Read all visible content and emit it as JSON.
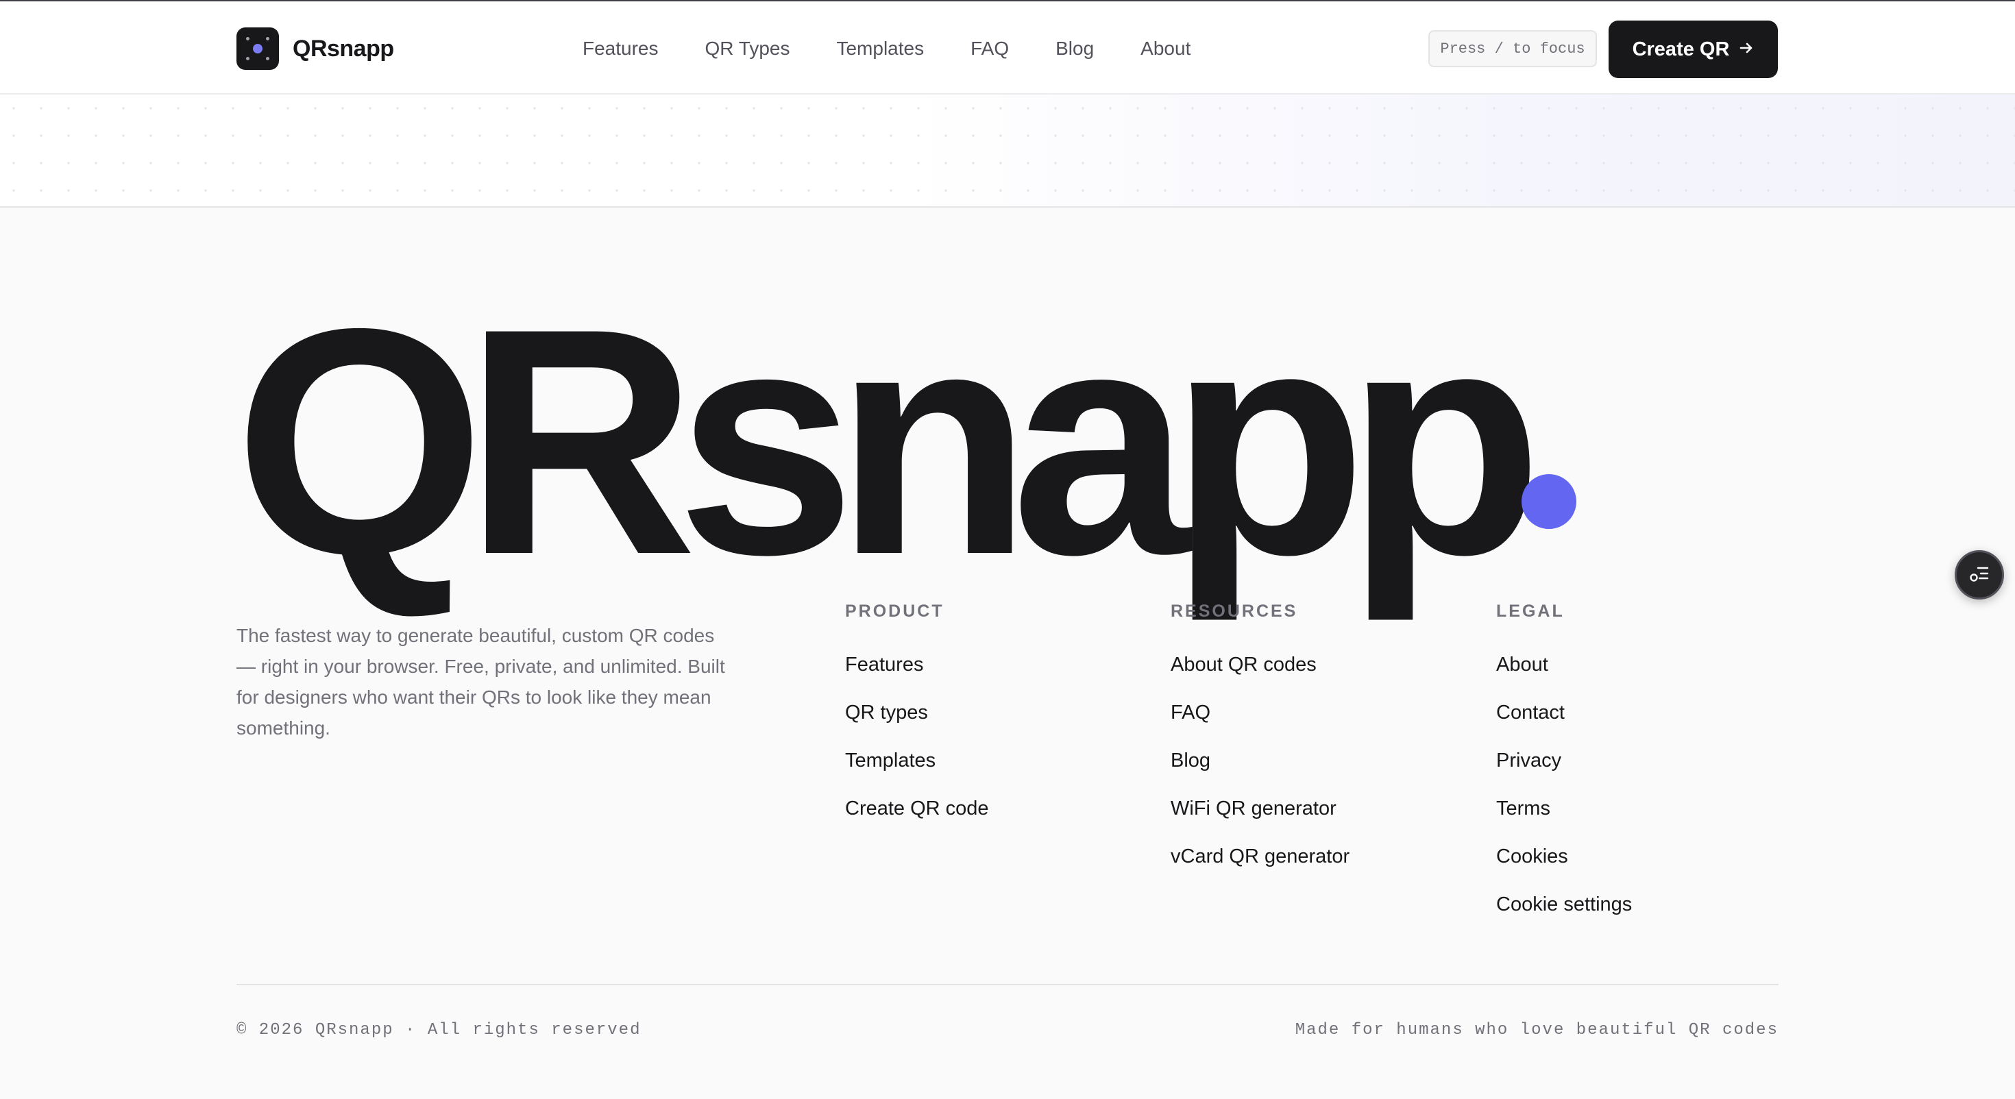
{
  "header": {
    "brand_name": "QRsnapp",
    "brand_icon": "qr-dot-logo-icon",
    "nav": [
      {
        "label": "Features"
      },
      {
        "label": "QR Types"
      },
      {
        "label": "Templates"
      },
      {
        "label": "FAQ"
      },
      {
        "label": "Blog"
      },
      {
        "label": "About"
      }
    ],
    "search_hint": "Press / to focus",
    "cta_label": "Create QR",
    "cta_icon": "arrow-right-icon"
  },
  "footer": {
    "wordmark": "QRsnapp",
    "accent_color": "#6366f1",
    "tagline": "The fastest way to generate beautiful, custom QR codes — right in your browser. Free, private, and unlimited. Built for designers who want their QRs to look like they mean something.",
    "columns": [
      {
        "title": "PRODUCT",
        "links": [
          "Features",
          "QR types",
          "Templates",
          "Create QR code"
        ]
      },
      {
        "title": "RESOURCES",
        "links": [
          "About QR codes",
          "FAQ",
          "Blog",
          "WiFi QR generator",
          "vCard QR generator"
        ]
      },
      {
        "title": "LEGAL",
        "links": [
          "About",
          "Contact",
          "Privacy",
          "Terms",
          "Cookies",
          "Cookie settings"
        ]
      }
    ],
    "copyright": "© 2026 QRsnapp · All rights reserved",
    "made_for": "Made for humans who love beautiful QR codes"
  },
  "floating_button": {
    "icon": "cookie-preferences-icon"
  }
}
